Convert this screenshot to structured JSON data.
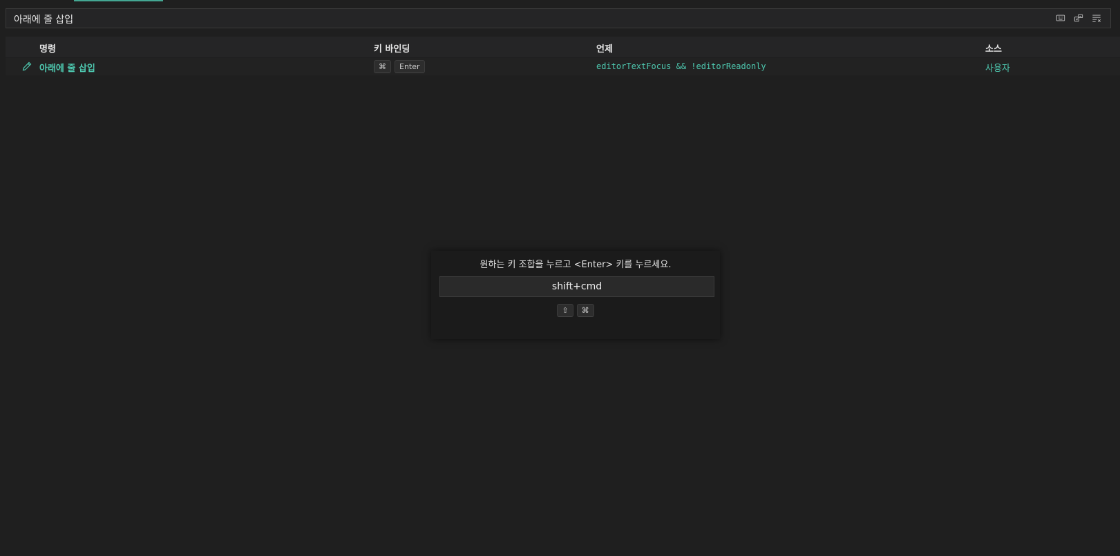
{
  "search": {
    "value": "아래에 줄 삽입"
  },
  "toolbar": {
    "icons": [
      "keyboard-icon",
      "record-keys-icon",
      "clear-filter-icon"
    ]
  },
  "table": {
    "columns": {
      "command": "명령",
      "keybinding": "키 바인딩",
      "when": "언제",
      "source": "소스"
    },
    "rows": [
      {
        "command": "아래에 줄 삽입",
        "keys": [
          "⌘",
          "Enter"
        ],
        "when": "editorTextFocus && !editorReadonly",
        "source": "사용자"
      }
    ]
  },
  "dialog": {
    "message": "원하는 키 조합을 누르고 <Enter> 키를 누르세요.",
    "input_value": "shift+cmd",
    "keys": [
      "⇧",
      "⌘"
    ]
  },
  "colors": {
    "accent": "#4ec9b0",
    "background": "#1f1f1f"
  }
}
